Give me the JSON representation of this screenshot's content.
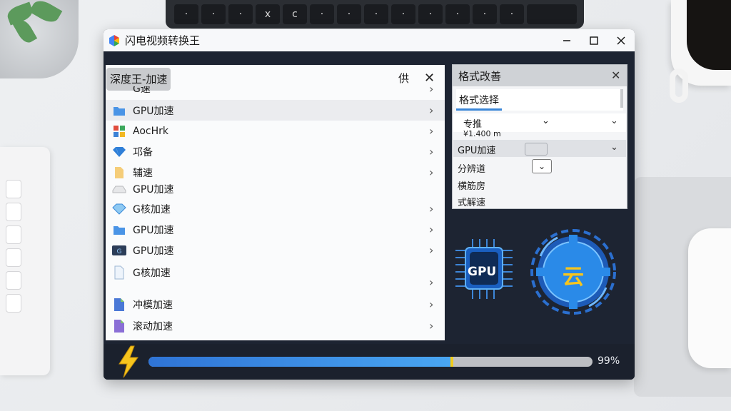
{
  "window": {
    "title": "闪电视频转换王"
  },
  "left_panel": {
    "tab_label": "深度王-加速",
    "tag": "供",
    "partial_top_label": "G速",
    "items": [
      {
        "label": "GPU加速",
        "icon": "folder-icon",
        "selected": true
      },
      {
        "label": "AocHrk",
        "icon": "app-icon",
        "selected": false
      },
      {
        "label": "邛备",
        "icon": "diamond-icon",
        "selected": false
      },
      {
        "label": "辅速",
        "icon": "file-icon",
        "selected": false
      },
      {
        "label": "GPU加速",
        "icon": "drive-icon",
        "selected": false
      },
      {
        "label": "G核加速",
        "icon": "diamond-icon",
        "selected": false
      },
      {
        "label": "GPU加速",
        "icon": "folder-icon",
        "selected": false
      },
      {
        "label": "GPU加速",
        "icon": "gpu-icon",
        "selected": false
      },
      {
        "label": "G核加速",
        "icon": "document-icon",
        "selected": false
      },
      {
        "label": "冲模加速",
        "icon": "document-icon",
        "selected": false
      },
      {
        "label": "滚动加速",
        "icon": "document-icon",
        "selected": false
      }
    ]
  },
  "right_panel": {
    "title": "格式改善",
    "sub_tab": "格式选择",
    "dropdown_label": "专推",
    "small_note": "¥1.400 m",
    "gpu_row_label": "GPU加速",
    "row_a": "分辨道",
    "row_b": "横筋房",
    "row_c": "式解速"
  },
  "graphics": {
    "gpu_chip_text": "GPU",
    "gear_glyph": "云"
  },
  "progress": {
    "value": 0.68,
    "label": "99%"
  },
  "colors": {
    "accent_blue": "#3a86d8",
    "bolt_yellow": "#f7c51d",
    "window_dark": "#1d2432"
  }
}
